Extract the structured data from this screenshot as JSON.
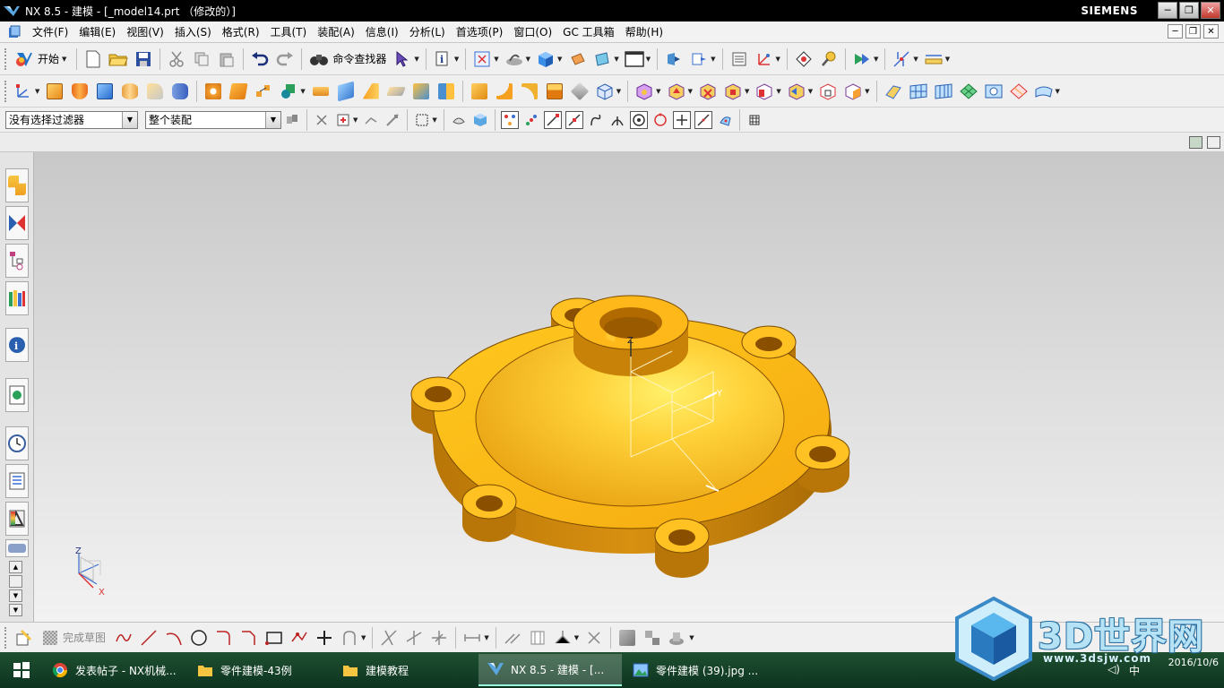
{
  "window": {
    "title": "NX 8.5 - 建模 - [_model14.prt （修改的）]",
    "brand": "SIEMENS",
    "minimize_glyph": "─",
    "restore_glyph": "❐",
    "close_glyph": "✕"
  },
  "menubar": {
    "items": [
      "文件(F)",
      "编辑(E)",
      "视图(V)",
      "插入(S)",
      "格式(R)",
      "工具(T)",
      "装配(A)",
      "信息(I)",
      "分析(L)",
      "首选项(P)",
      "窗口(O)",
      "GC 工具箱",
      "帮助(H)"
    ],
    "mdi_min": "─",
    "mdi_restore": "❐",
    "mdi_close": "✕"
  },
  "toolbar1": {
    "start_label": "开始",
    "command_finder_label": "命令查找器"
  },
  "selection_bar": {
    "filter_value": "没有选择过滤器",
    "scope_value": "整个装配"
  },
  "sketch_bar": {
    "finish_sketch_label": "完成草图"
  },
  "viewport": {
    "triad_labels": {
      "z": "Z",
      "y": "Y"
    },
    "wcs_labels": {
      "z": "Z",
      "x": "X"
    },
    "model_color": "#f7b515"
  },
  "taskbar": {
    "tasks": [
      {
        "label": "发表帖子 - NX机械...",
        "icon": "chrome-icon"
      },
      {
        "label": "零件建模-43例",
        "icon": "folder-icon"
      },
      {
        "label": "建模教程",
        "icon": "folder-icon"
      },
      {
        "label": "NX 8.5 - 建模 - [...",
        "icon": "nx-icon"
      },
      {
        "label": "零件建模 (39).jpg ...",
        "icon": "image-viewer-icon"
      }
    ],
    "tray_lang": "中",
    "tray_time": "",
    "tray_date": "2016/10/6"
  },
  "watermark": {
    "text": "3D世界网",
    "url": "www.3dsjw.com"
  }
}
